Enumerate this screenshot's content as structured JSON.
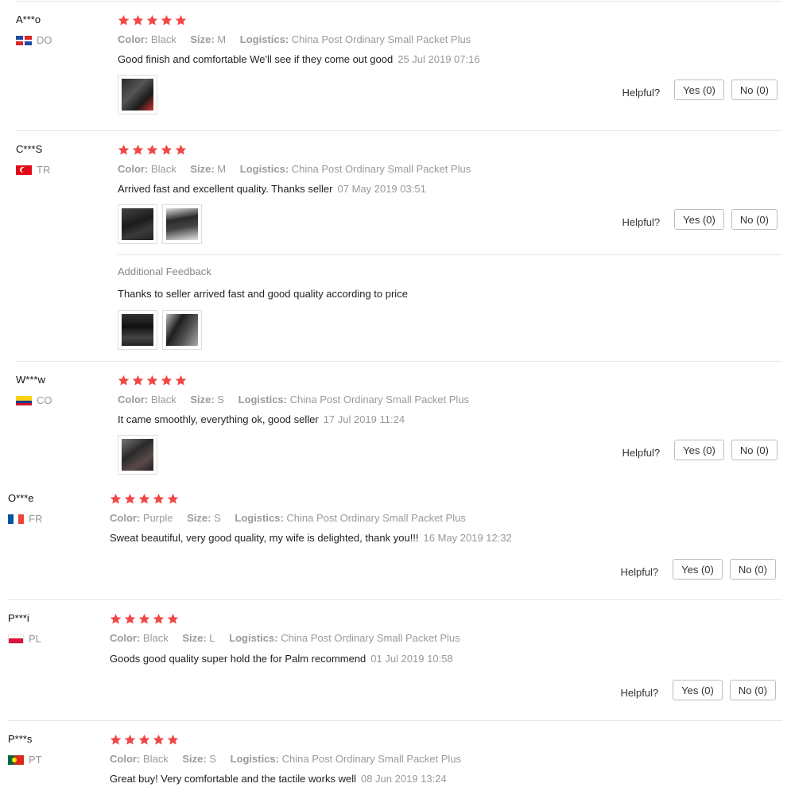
{
  "labels": {
    "color": "Color:",
    "size": "Size:",
    "logistics": "Logistics:",
    "helpful": "Helpful?",
    "additional": "Additional Feedback"
  },
  "star_color": "#f04848",
  "reviews": [
    {
      "user": "A***o",
      "country": "DO",
      "rating": 5,
      "color": "Black",
      "size": "M",
      "logistics": "China Post Ordinary Small Packet Plus",
      "text": "Good finish and comfortable We'll see if they come out good",
      "date": "25 Jul 2019 07:16",
      "yes": "Yes (0)",
      "no": "No (0)"
    },
    {
      "user": "C***S",
      "country": "TR",
      "rating": 5,
      "color": "Black",
      "size": "M",
      "logistics": "China Post Ordinary Small Packet Plus",
      "text": "Arrived fast and excellent quality. Thanks seller",
      "date": "07 May 2019 03:51",
      "yes": "Yes (0)",
      "no": "No (0)",
      "additional_text": "Thanks to seller arrived fast and good quality according to price"
    },
    {
      "user": "W***w",
      "country": "CO",
      "rating": 5,
      "color": "Black",
      "size": "S",
      "logistics": "China Post Ordinary Small Packet Plus",
      "text": "It came smoothly, everything ok, good seller",
      "date": "17 Jul 2019 11:24",
      "yes": "Yes (0)",
      "no": "No (0)"
    },
    {
      "user": "O***e",
      "country": "FR",
      "rating": 5,
      "color": "Purple",
      "size": "S",
      "logistics": "China Post Ordinary Small Packet Plus",
      "text": "Sweat beautiful, very good quality, my wife is delighted, thank you!!!",
      "date": "16 May 2019 12:32",
      "yes": "Yes (0)",
      "no": "No (0)"
    },
    {
      "user": "P***i",
      "country": "PL",
      "rating": 5,
      "color": "Black",
      "size": "L",
      "logistics": "China Post Ordinary Small Packet Plus",
      "text": "Goods good quality super hold the for Palm recommend",
      "date": "01 Jul 2019 10:58",
      "yes": "Yes (0)",
      "no": "No (0)"
    },
    {
      "user": "P***s",
      "country": "PT",
      "rating": 5,
      "color": "Black",
      "size": "S",
      "logistics": "China Post Ordinary Small Packet Plus",
      "text": "Great buy! Very comfortable and the tactile works well",
      "date": "08 Jun 2019 13:24"
    }
  ]
}
